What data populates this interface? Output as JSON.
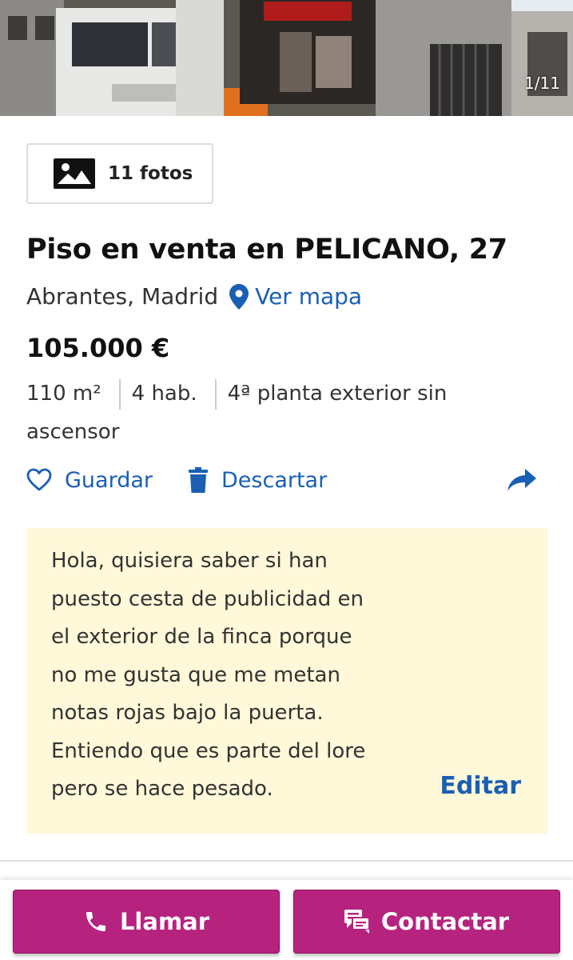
{
  "photo": {
    "counter": "1/11"
  },
  "photos_button": {
    "label": "11 fotos",
    "icon": "image-icon"
  },
  "listing": {
    "title": "Piso en venta en PELICANO, 27",
    "location": "Abrantes, Madrid",
    "map_link": "Ver mapa",
    "price": "105.000 €",
    "features": {
      "area": "110 m²",
      "rooms": "4 hab.",
      "floor": "4ª planta exterior sin ascensor"
    }
  },
  "actions": {
    "save": "Guardar",
    "discard": "Descartar",
    "share_icon": "share-icon"
  },
  "note": {
    "text": "Hola, quisiera saber si han\npuesto cesta de publicidad en\nel exterior de la finca porque\nno me gusta que me metan\nnotas rojas bajo la puerta.\nEntiendo que es parte del lore\npero se hace pesado.",
    "edit": "Editar"
  },
  "bottom_bar": {
    "call": "Llamar",
    "contact": "Contactar"
  },
  "colors": {
    "link": "#1a5fb4",
    "cta": "#b5237f",
    "note_bg": "#fff8d9"
  }
}
